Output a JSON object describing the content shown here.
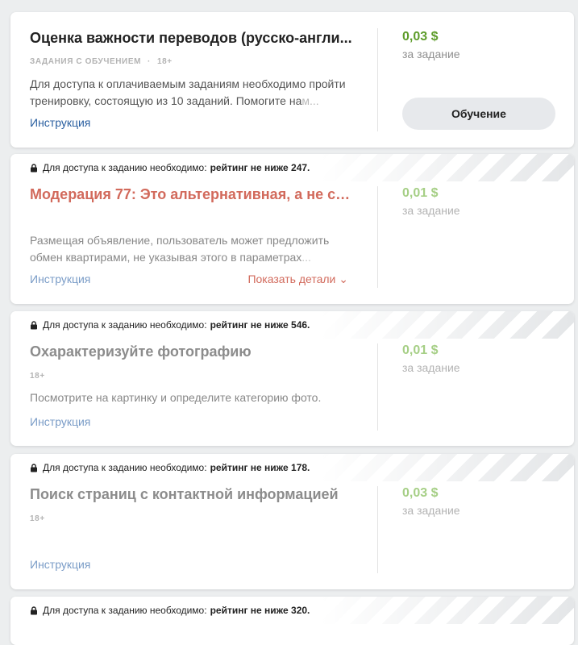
{
  "tasks": [
    {
      "title": "Оценка важности переводов (русско-англи...",
      "tag": "ЗАДАНИЯ С ОБУЧЕНИЕМ",
      "age": "18+",
      "desc_main": "Для доступа к оплачиваемым заданиям необходимо пройти тренировку, состоящую из 10 заданий. Помогите на",
      "desc_fade": "м...",
      "instruction": "Инструкция",
      "price": "0,03 $",
      "per": "за задание",
      "button": "Обучение"
    },
    {
      "lock_text": "Для доступа к заданию необходимо:",
      "lock_req": "рейтинг не ниже 247.",
      "title": "Модерация 77: Это альтернативная, а не св...",
      "desc_main": "Размещая объявление, пользователь может предложить обмен квартирами, не указывая этого в параметрах",
      "desc_fade": "...",
      "instruction": "Инструкция",
      "details": "Показать детали ⌄",
      "price": "0,01 $",
      "per": "за задание"
    },
    {
      "lock_text": "Для доступа к заданию необходимо:",
      "lock_req": "рейтинг не ниже 546.",
      "title": "Охарактеризуйте фотографию",
      "age": "18+",
      "desc_main": "Посмотрите на картинку и определите категорию фото.",
      "instruction": "Инструкция",
      "price": "0,01 $",
      "per": "за задание"
    },
    {
      "lock_text": "Для доступа к заданию необходимо:",
      "lock_req": "рейтинг не ниже 178.",
      "title": "Поиск страниц с контактной информацией",
      "age": "18+",
      "instruction": "Инструкция",
      "price": "0,03 $",
      "per": "за задание"
    },
    {
      "lock_text": "Для доступа к заданию необходимо:",
      "lock_req": "рейтинг не ниже 320."
    }
  ],
  "colors": {
    "price_green": "#5e9c2b",
    "link_blue": "#2a5fa0",
    "accent_red": "#d26a5c",
    "page_bg": "#eceeef"
  }
}
